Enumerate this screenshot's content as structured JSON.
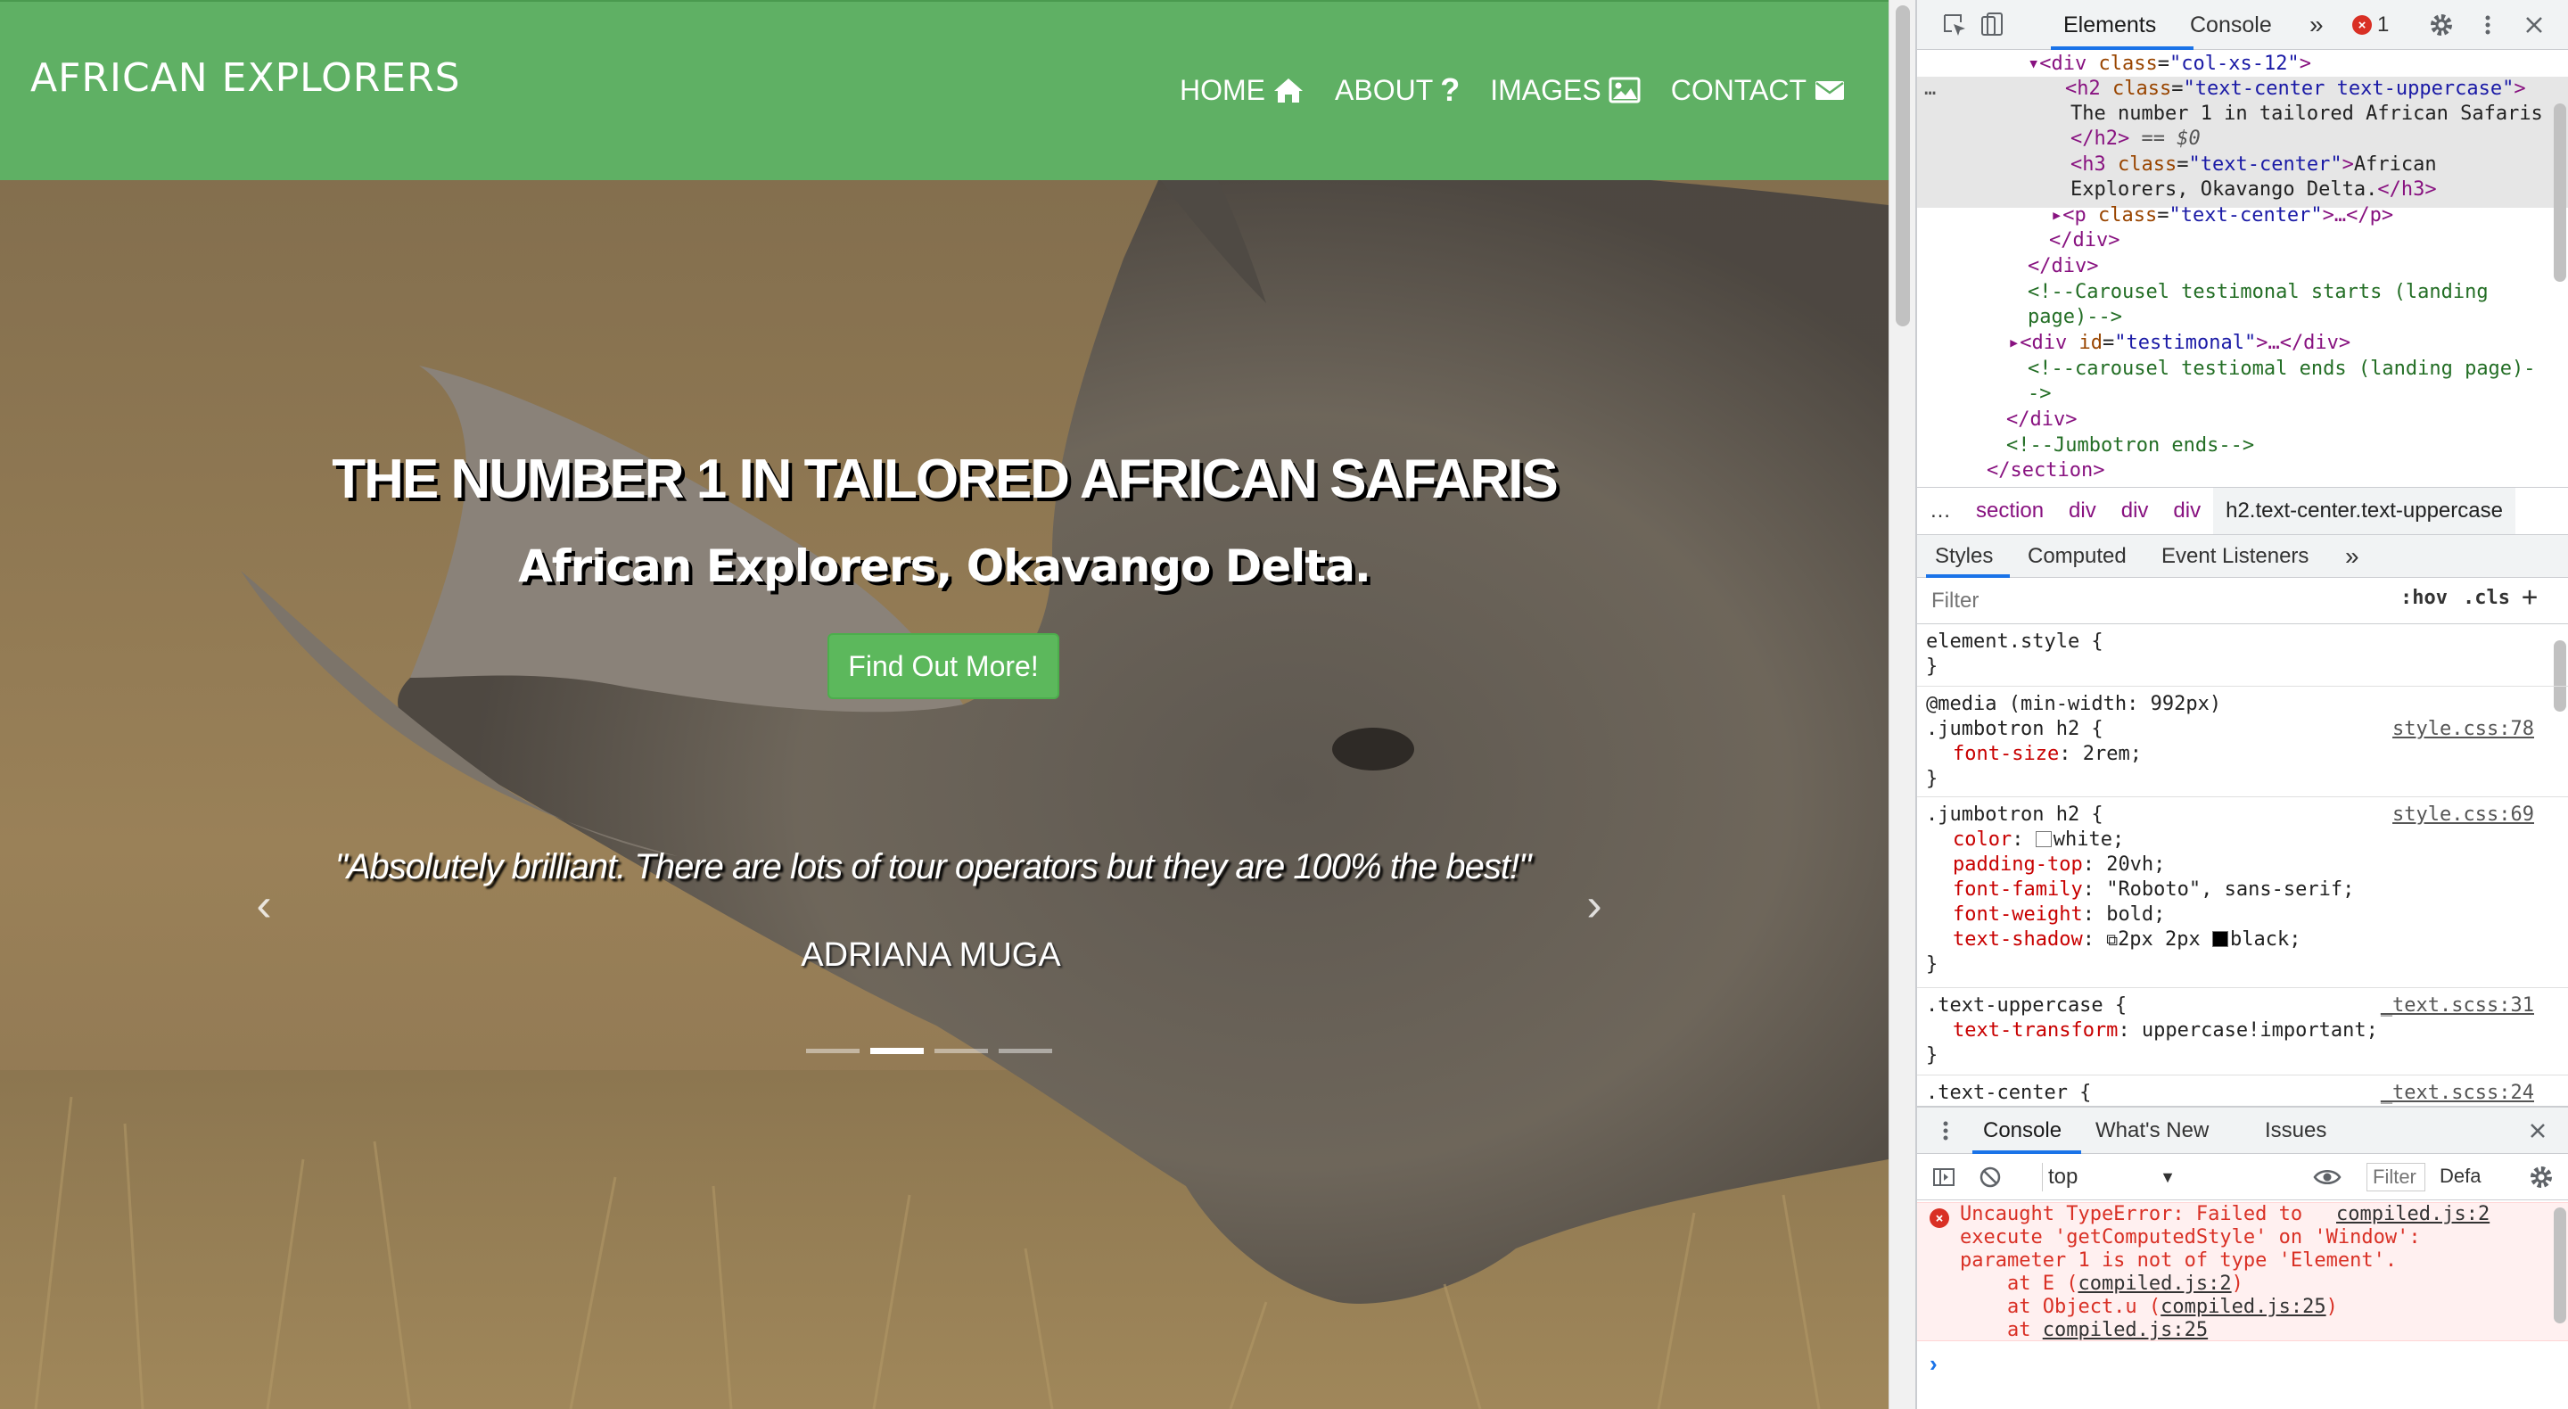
{
  "site": {
    "brand": "AFRICAN EXPLORERS",
    "nav": [
      {
        "label": "HOME",
        "icon": "home-icon"
      },
      {
        "label": "ABOUT",
        "icon": "question-icon"
      },
      {
        "label": "IMAGES",
        "icon": "image-icon"
      },
      {
        "label": "CONTACT",
        "icon": "envelope-icon"
      }
    ],
    "hero": {
      "title": "THE NUMBER 1 IN TAILORED AFRICAN SAFARIS",
      "subtitle": "African Explorers, Okavango Delta.",
      "cta": "Find Out More!",
      "quote": "\"Absolutely brilliant. There are lots of tour operators but they are 100% the best!\"",
      "author": "ADRIANA MUGA",
      "indicator_count": 4,
      "active_indicator": 1,
      "prev_arrow": "‹",
      "next_arrow": "›"
    },
    "colors": {
      "navbar": "#5fb064",
      "button": "#5cb85c"
    }
  },
  "devtools": {
    "tabs": {
      "elements": "Elements",
      "console": "Console",
      "more": "»"
    },
    "error_count": "1",
    "dom": {
      "l1": {
        "open": "▾<",
        "tag": "div",
        "attr": " class",
        "val": "\"col-xs-12\"",
        "close": ">"
      },
      "l2": {
        "tag": "<h2",
        "attr": " class",
        "val": "\"text-center text-uppercase\"",
        "close": ">"
      },
      "l3": "The number 1 in tailored African Safaris",
      "l4": {
        "close": "</h2>",
        "eq": " == $0"
      },
      "l5": {
        "tag": "<h3",
        "attr": " class",
        "val": "\"text-center\"",
        "close": ">",
        "text": "African"
      },
      "l6": {
        "text": "Explorers, Okavango Delta.",
        "close": "</h3>"
      },
      "l7": {
        "open": "▸<",
        "tag": "p",
        "attr": " class",
        "val": "\"text-center\"",
        "rest": ">…</p>"
      },
      "l8": "</div>",
      "l9": "</div>",
      "l10": "<!--Carousel testimonal starts (landing",
      "l11": "page)-->",
      "l12": {
        "open": "▸<",
        "tag": "div",
        "attr": " id",
        "val": "\"testimonal\"",
        "rest": ">…</div>"
      },
      "l13": "<!--carousel testiomal ends (landing page)-",
      "l14": "->",
      "l15": "</div>",
      "l16": "<!--Jumbotron ends-->",
      "l17": "</section>",
      "ellipsis": "…"
    },
    "breadcrumbs": [
      "…",
      "section",
      "div",
      "div",
      "div",
      "h2.text-center.text-uppercase"
    ],
    "styles_tabs": {
      "styles": "Styles",
      "computed": "Computed",
      "events": "Event Listeners",
      "more": "»"
    },
    "filter": {
      "placeholder": "Filter",
      "hov": ":hov",
      "cls": ".cls",
      "add": "+"
    },
    "rules": {
      "element_style": "element.style {",
      "close": "}",
      "media": "@media (min-width: 992px)",
      "r1_selector": ".jumbotron h2 {",
      "r1_src": "style.css:78",
      "r1_p1": "font-size",
      "r1_v1": ": 2rem;",
      "r2_selector": ".jumbotron h2 {",
      "r2_src": "style.css:69",
      "r2_p1": "color",
      "r2_v1": "white;",
      "r2_p2": "padding-top",
      "r2_v2": ": 20vh;",
      "r2_p3": "font-family",
      "r2_v3": ": \"Roboto\", sans-serif;",
      "r2_p4": "font-weight",
      "r2_v4": ": bold;",
      "r2_p5": "text-shadow",
      "r2_v5a": "2px 2px ",
      "r2_v5b": "black;",
      "r3_selector": ".text-uppercase {",
      "r3_src": "_text.scss:31",
      "r3_p1": "text-transform",
      "r3_v1": ": uppercase!important;",
      "r4_selector": ".text-center {",
      "r4_src": "_text.scss:24"
    },
    "drawer": {
      "tabs": {
        "console": "Console",
        "whats_new": "What's New",
        "issues": "Issues"
      },
      "context": "top",
      "filter_placeholder": "Filter",
      "level": "Defa",
      "error": {
        "l1": "Uncaught TypeError: Failed to",
        "l1_link": "compiled.js:2",
        "l2": "execute 'getComputedStyle' on 'Window':",
        "l3": "parameter 1 is not of type 'Element'.",
        "l4_pre": "    at E (",
        "l4_link": "compiled.js:2",
        "l4_post": ")",
        "l5_pre": "    at Object.u (",
        "l5_link": "compiled.js:25",
        "l5_post": ")",
        "l6_pre": "    at ",
        "l6_link": "compiled.js:25"
      },
      "prompt": "›"
    }
  }
}
